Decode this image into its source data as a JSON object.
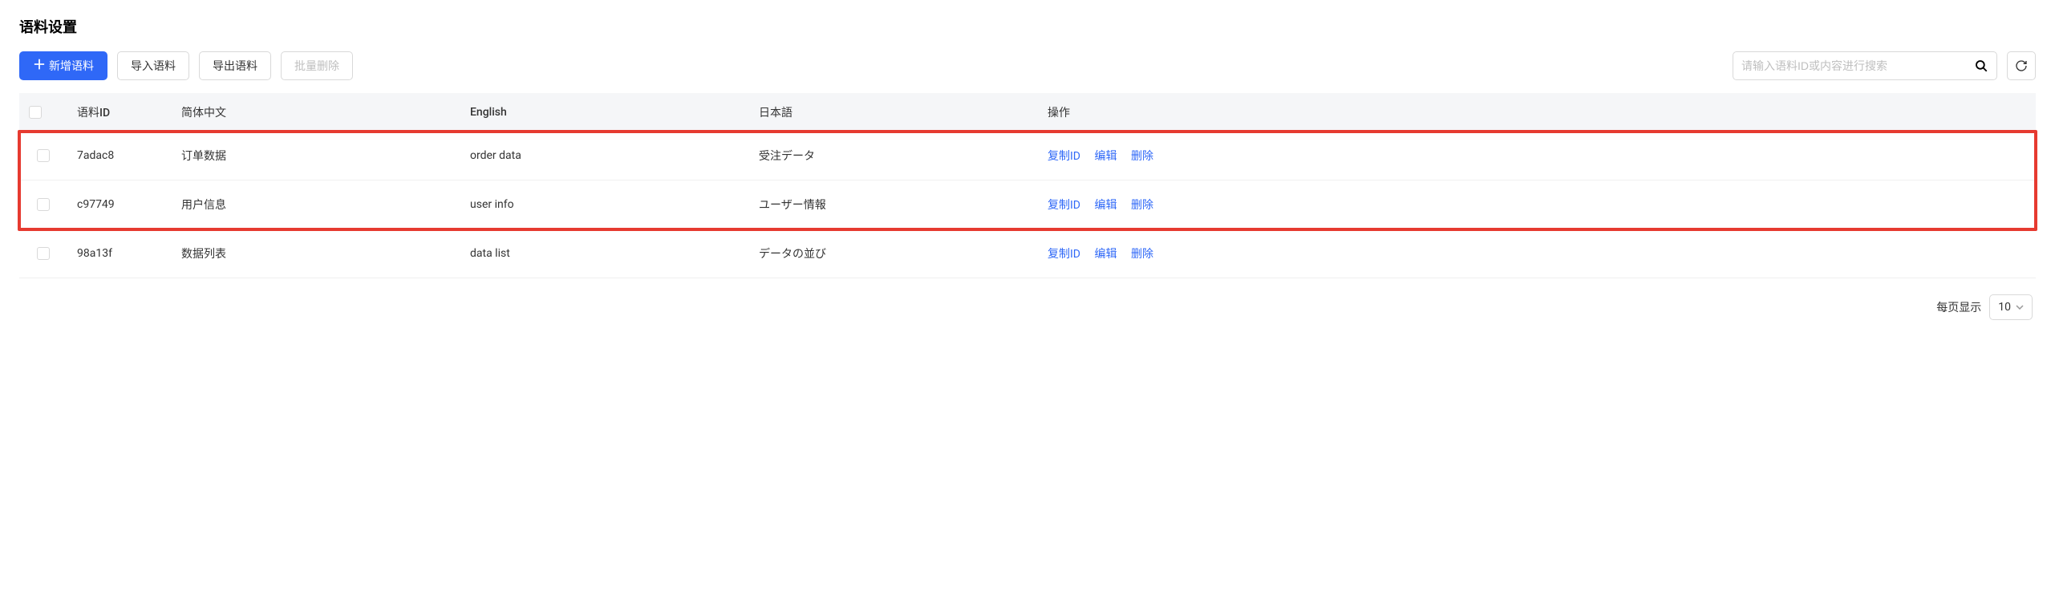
{
  "page_title": "语料设置",
  "toolbar": {
    "add_label": "新增语料",
    "import_label": "导入语料",
    "export_label": "导出语料",
    "batch_delete_label": "批量删除"
  },
  "search": {
    "placeholder": "请输入语料ID或内容进行搜索"
  },
  "table": {
    "headers": {
      "id": "语料ID",
      "zh": "简体中文",
      "en": "English",
      "ja": "日本語",
      "action": "操作"
    },
    "rows": [
      {
        "id": "7adac8",
        "zh": "订单数据",
        "en": "order data",
        "ja": "受注データ"
      },
      {
        "id": "c97749",
        "zh": "用户信息",
        "en": "user info",
        "ja": "ユーザー情報"
      },
      {
        "id": "98a13f",
        "zh": "数据列表",
        "en": "data list",
        "ja": "データの並び"
      }
    ],
    "actions": {
      "copy_id": "复制ID",
      "edit": "编辑",
      "delete": "删除"
    }
  },
  "pagination": {
    "label": "每页显示",
    "page_size": "10"
  }
}
